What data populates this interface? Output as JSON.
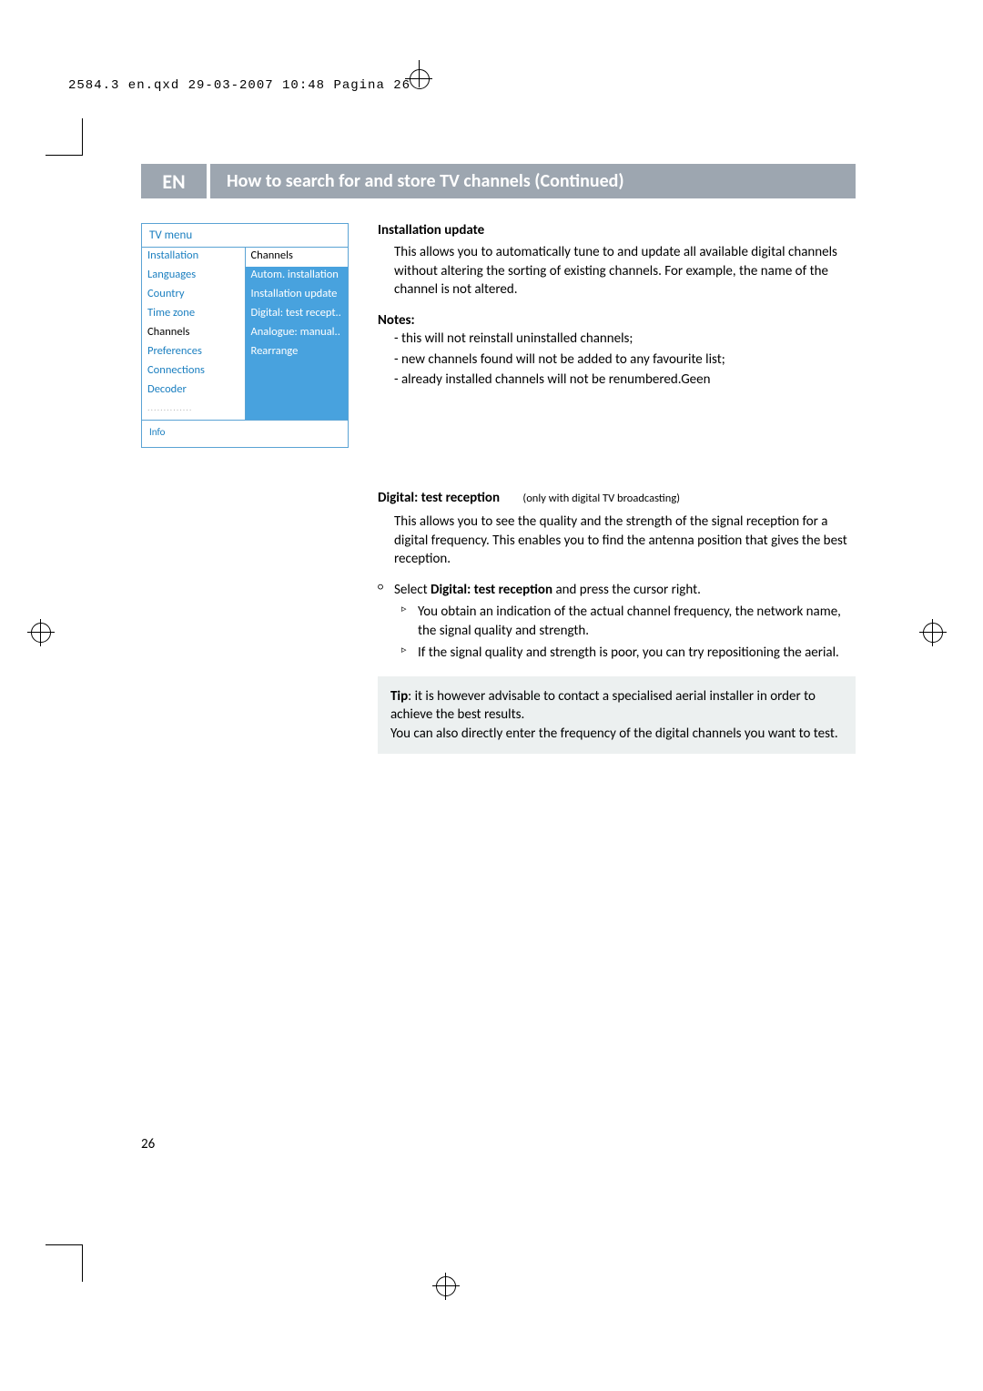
{
  "meta_header": "2584.3 en.qxd  29-03-2007  10:48  Pagina 26",
  "lang_badge": "EN",
  "page_title": "How to search for and store TV channels  (Continued)",
  "menu": {
    "title": "TV menu",
    "left": {
      "r1": "Installation",
      "r2": "Languages",
      "r3": "Country",
      "r4": "Time zone",
      "r5": "Channels",
      "r6": "Preferences",
      "r7": "Connections",
      "r8": "Decoder",
      "r9": ".............."
    },
    "right": {
      "r1": "Channels",
      "r2": "Autom. installation",
      "r3": "Installation update",
      "r4": "Digital: test recept..",
      "r5": "Analogue: manual..",
      "r6": "Rearrange"
    },
    "info": "Info"
  },
  "section1": {
    "title": "Installation update",
    "body": "This allows you to automatically tune to and update all available digital channels without altering the sorting of existing channels. For example, the name of the channel is not altered.",
    "notes_label": "Notes",
    "n1": "- this will not reinstall uninstalled channels;",
    "n2": "- new channels found will not be added to any favourite list;",
    "n3": "- already installed channels will not be renumbered.Geen"
  },
  "section2": {
    "title": "Digital: test reception",
    "sub": "(only with digital TV broadcasting)",
    "body": "This allows you to see the quality and the strength of the signal reception for a digital frequency. This enables you to find the antenna position that gives the best reception.",
    "step1a": "Select ",
    "step1b": "Digital: test reception",
    "step1c": " and press the cursor right.",
    "sub1": "You obtain an indication of the actual channel frequency, the network name, the signal quality and strength.",
    "sub2": "If the signal quality and strength is poor, you can try repositioning the aerial."
  },
  "tip": {
    "label": "Tip",
    "body1": ": it is however advisable to contact a specialised aerial installer in order to achieve the best results.",
    "body2": "You can also directly enter the frequency of the digital channels you want to test."
  },
  "page_number": "26"
}
